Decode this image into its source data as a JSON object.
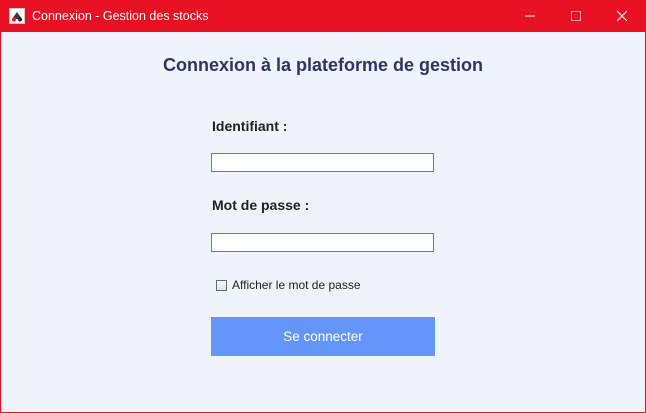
{
  "window": {
    "title": "Connexion - Gestion des stocks",
    "accent_color": "#e81123",
    "icon": "java-app-icon",
    "controls": [
      "minimize-icon",
      "maximize-icon",
      "close-icon"
    ]
  },
  "form": {
    "heading": "Connexion à la plateforme de gestion",
    "username_label": "Identifiant :",
    "username_value": "",
    "password_label": "Mot de passe :",
    "password_value": "",
    "show_password_label": "Afficher le mot de passe",
    "show_password_checked": false,
    "submit_label": "Se connecter",
    "submit_color": "#6495fb"
  }
}
